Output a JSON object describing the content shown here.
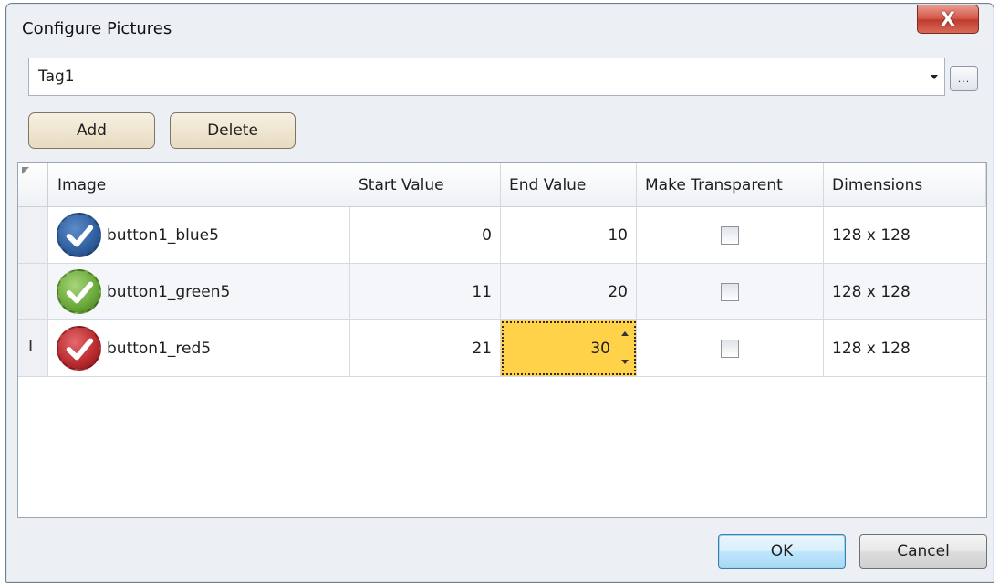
{
  "window": {
    "title": "Configure Pictures",
    "close_glyph": "X"
  },
  "tag_select": {
    "value": "Tag1",
    "browse_label": "..."
  },
  "toolbar": {
    "add_label": "Add",
    "delete_label": "Delete"
  },
  "grid": {
    "columns": [
      "Image",
      "Start Value",
      "End Value",
      "Make Transparent",
      "Dimensions"
    ],
    "rows": [
      {
        "image_name": "button1_blue5",
        "icon": "blue-check-icon",
        "color": "#2f5f9e",
        "start": "0",
        "end": "10",
        "transparent": false,
        "dimensions": "128 x 128"
      },
      {
        "image_name": "button1_green5",
        "icon": "green-check-icon",
        "color": "#6aa83a",
        "start": "11",
        "end": "20",
        "transparent": false,
        "dimensions": "128 x 128"
      },
      {
        "image_name": "button1_red5",
        "icon": "red-check-icon",
        "color": "#b92a2e",
        "start": "21",
        "end": "30",
        "transparent": false,
        "dimensions": "128 x 128",
        "editing_cell": "end"
      }
    ],
    "row_cursor_glyph": "I"
  },
  "dialog_buttons": {
    "ok_label": "OK",
    "cancel_label": "Cancel"
  },
  "colors": {
    "edit_highlight": "#ffd24a",
    "window_bg": "#ecf0f5"
  }
}
